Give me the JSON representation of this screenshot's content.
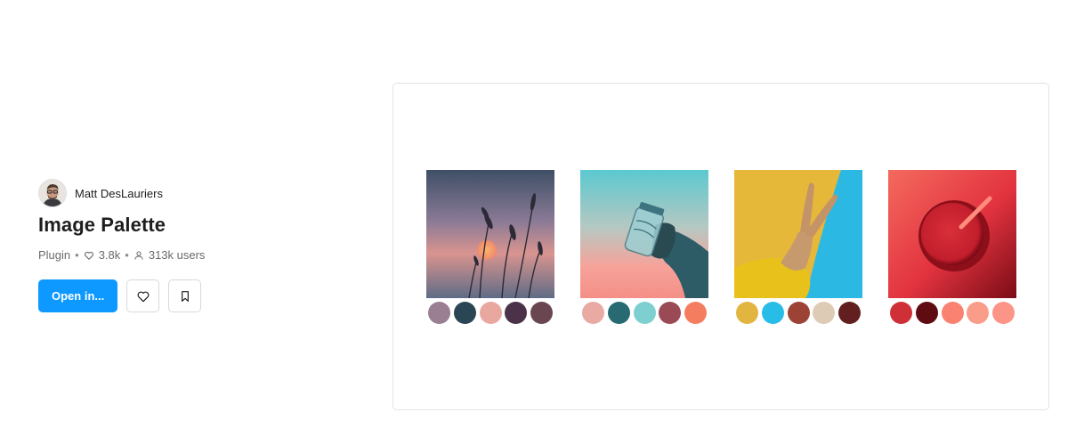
{
  "author": {
    "name": "Matt DesLauriers"
  },
  "title": "Image Palette",
  "meta": {
    "type": "Plugin",
    "likes": "3.8k",
    "users": "313k users"
  },
  "actions": {
    "open_label": "Open in..."
  },
  "palettes": [
    {
      "swatches": [
        "#9a7f92",
        "#2a4654",
        "#e8a8a0",
        "#4b3248",
        "#6a4650"
      ]
    },
    {
      "swatches": [
        "#e8aaa3",
        "#276a72",
        "#7ecfd0",
        "#9a4a55",
        "#f47d5f"
      ]
    },
    {
      "swatches": [
        "#e2b540",
        "#28bde6",
        "#9d4336",
        "#decbb6",
        "#621f1f"
      ]
    },
    {
      "swatches": [
        "#cf3038",
        "#5e0c12",
        "#f98270",
        "#fa9c8a",
        "#fc9488"
      ]
    }
  ]
}
